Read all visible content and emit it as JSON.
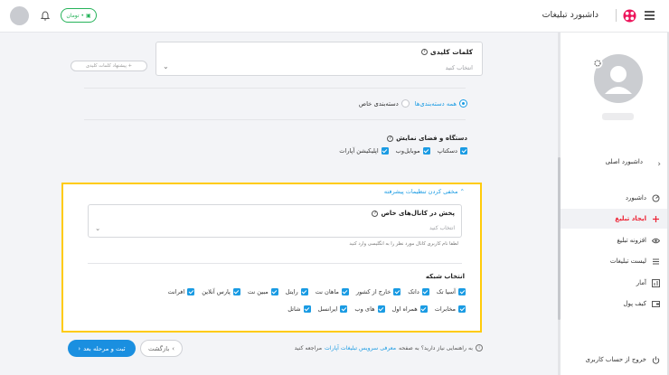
{
  "header": {
    "title": "داشبورد تبلیغات",
    "wallet_label": "• تومان"
  },
  "sidebar": {
    "main_dashboard": "داشبورد اصلی",
    "items": [
      {
        "label": "داشبورد",
        "icon": "dashboard-icon"
      },
      {
        "label": "ایجاد تبلیغ",
        "icon": "plus-icon",
        "active": true
      },
      {
        "label": "افزونه تبلیغ",
        "icon": "eye-icon"
      },
      {
        "label": "لیست تبلیغات",
        "icon": "list-icon"
      },
      {
        "label": "آمار",
        "icon": "chart-icon"
      },
      {
        "label": "کیف پول",
        "icon": "wallet-icon"
      }
    ],
    "logout": "خروج از حساب کاربری"
  },
  "keywords": {
    "label": "کلمات کلیدی",
    "placeholder": "انتخاب کنید",
    "suggest": "+ پیشنهاد کلمات کلیدی"
  },
  "category": {
    "all": "همه دسته‌بندی‌ها",
    "specific": "دسته‌بندی خاص"
  },
  "device": {
    "title": "دستگاه و فضای نمایش",
    "options": [
      "دسکتاپ",
      "موبایل‌وب",
      "اپلیکیشن آپارات"
    ]
  },
  "advanced": {
    "toggle": "مخفی کردن تنظیمات پیشرفته",
    "channel_title": "پخش در کانال‌های خاص",
    "channel_placeholder": "انتخاب کنید",
    "channel_hint": "لطفا نام کاربری کانال مورد نظر را به انگلیسی وارد کنید",
    "network_title": "انتخاب شبکه",
    "networks_row1": [
      "آسیا تک",
      "داتک",
      "خارج از کشور",
      "ماهان نت",
      "رایتل",
      "مبین نت",
      "پارس آنلاین",
      "افرانت"
    ],
    "networks_row2": [
      "مخابرات",
      "همراه اول",
      "های وب",
      "ایرانسل",
      "شاتل"
    ]
  },
  "footer": {
    "help_prefix": "به راهنمایی نیاز دارید؟ به صفحه",
    "help_link": "معرفی سرویس تبلیغات آپارات",
    "help_suffix": "مراجعه کنید",
    "back": "بازگشت",
    "next": "ثبت و مرحله بعد"
  },
  "colors": {
    "accent": "#1a9be3",
    "highlight": "#ffcb0a",
    "active": "#e23"
  }
}
